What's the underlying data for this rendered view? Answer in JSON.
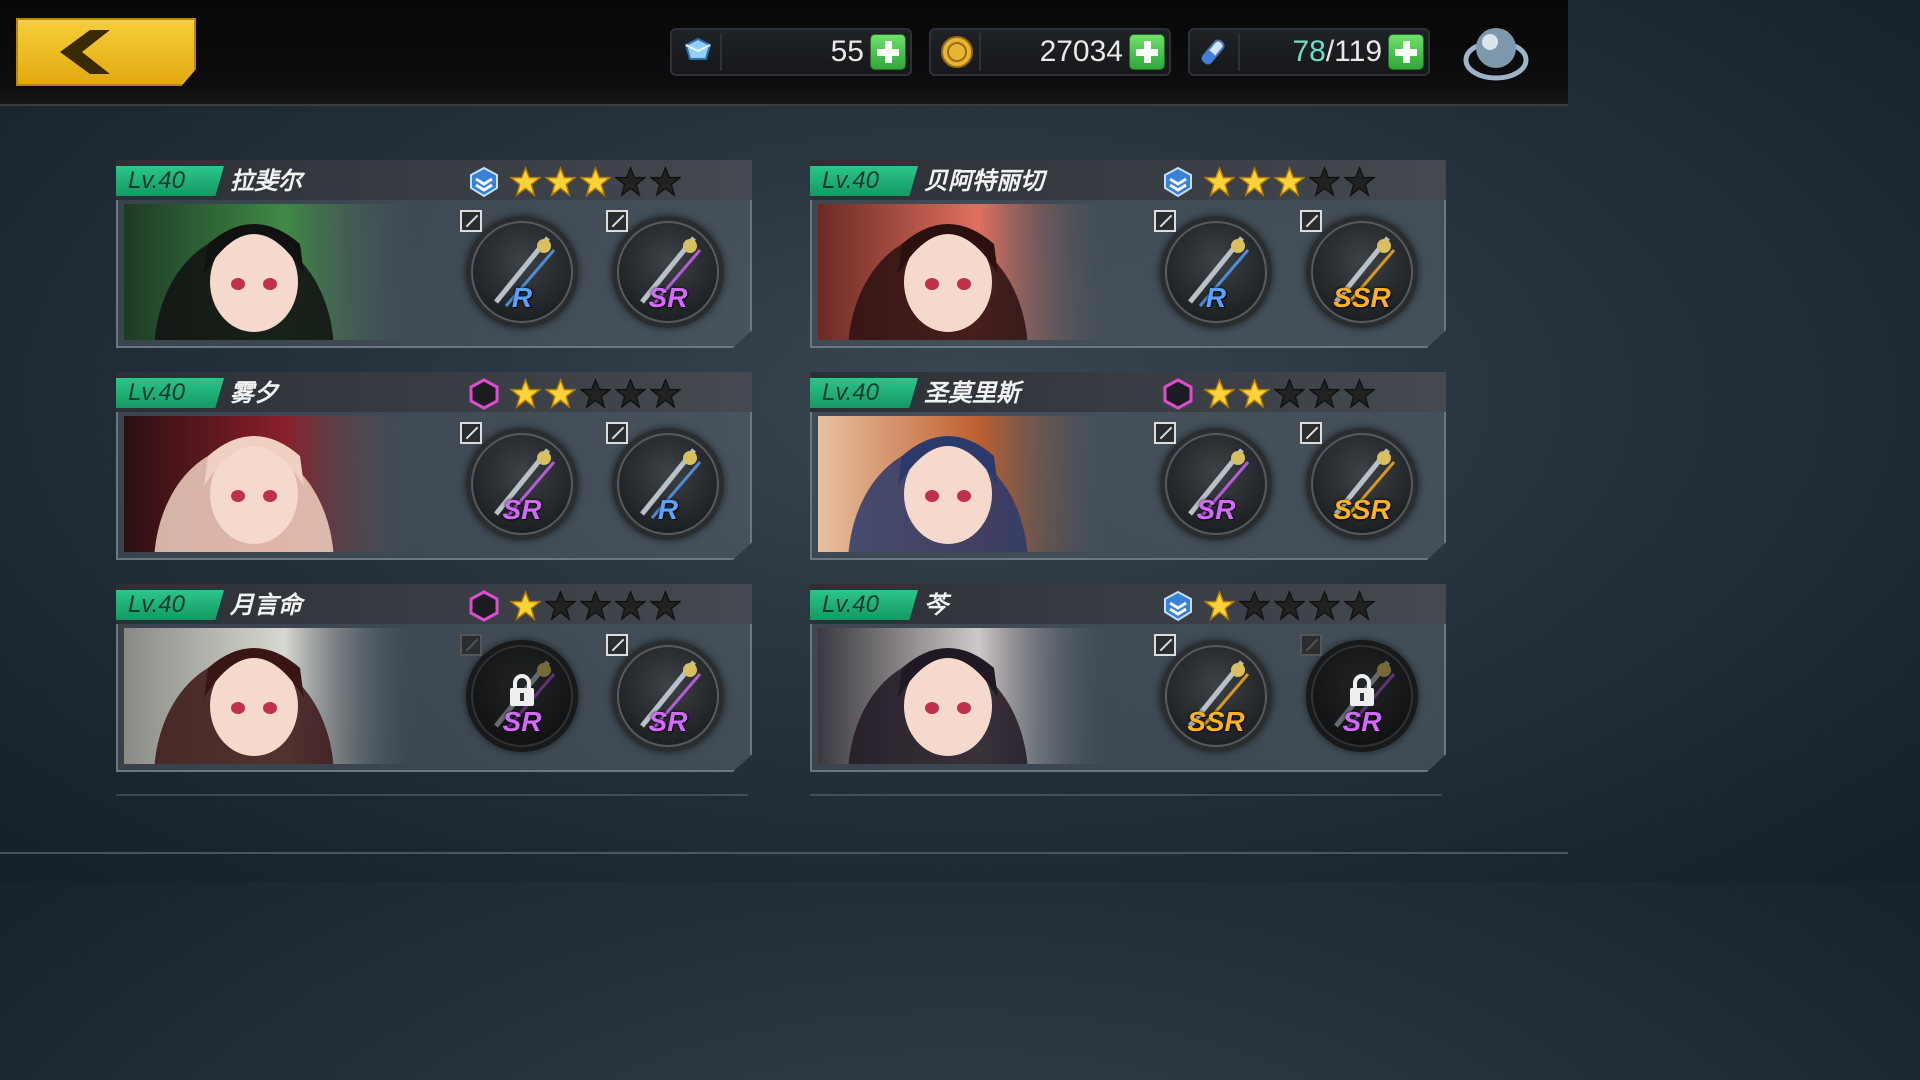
{
  "resources": {
    "diamonds": {
      "value": "55",
      "icon": "diamond-icon"
    },
    "gold": {
      "value": "27034",
      "icon": "gold-coin-icon"
    },
    "stamina": {
      "current": "78",
      "sep": "/",
      "max": "119",
      "icon": "stamina-icon"
    }
  },
  "colors": {
    "accent": "#f2c230",
    "level_badge": "#1fb577",
    "star_on": "#ffd23a",
    "star_off": "#222",
    "rar_R": "#5aa2ff",
    "rar_SR": "#d468ff",
    "rar_SSR": "#ffb21f"
  },
  "characters": [
    {
      "level": "Lv.40",
      "name": "拉斐尔",
      "role": "shield",
      "stars": 3,
      "weapons": [
        {
          "rarity": "R",
          "locked": false,
          "icon": "twin-fans-icon"
        },
        {
          "rarity": "SR",
          "locked": false,
          "icon": "chakram-icon"
        }
      ]
    },
    {
      "level": "Lv.40",
      "name": "贝阿特丽切",
      "role": "shield",
      "stars": 3,
      "weapons": [
        {
          "rarity": "R",
          "locked": false,
          "icon": "rapier-icon"
        },
        {
          "rarity": "SSR",
          "locked": false,
          "icon": "spear-icon"
        }
      ]
    },
    {
      "level": "Lv.40",
      "name": "雾夕",
      "role": "hexagon",
      "stars": 2,
      "weapons": [
        {
          "rarity": "SR",
          "locked": false,
          "icon": "fan-icon"
        },
        {
          "rarity": "R",
          "locked": false,
          "icon": "staff-icon"
        }
      ]
    },
    {
      "level": "Lv.40",
      "name": "圣莫里斯",
      "role": "hexagon",
      "stars": 2,
      "weapons": [
        {
          "rarity": "SR",
          "locked": false,
          "icon": "lance-icon"
        },
        {
          "rarity": "SSR",
          "locked": false,
          "icon": "shield-icon"
        }
      ]
    },
    {
      "level": "Lv.40",
      "name": "月言命",
      "role": "hexagon",
      "stars": 1,
      "weapons": [
        {
          "rarity": "SR",
          "locked": true,
          "icon": "scissors-icon"
        },
        {
          "rarity": "SR",
          "locked": false,
          "icon": "katana-icon"
        }
      ]
    },
    {
      "level": "Lv.40",
      "name": "芩",
      "role": "shield",
      "stars": 1,
      "weapons": [
        {
          "rarity": "SSR",
          "locked": false,
          "icon": "twin-swords-icon"
        },
        {
          "rarity": "SR",
          "locked": true,
          "icon": "blade-icon"
        }
      ]
    }
  ]
}
